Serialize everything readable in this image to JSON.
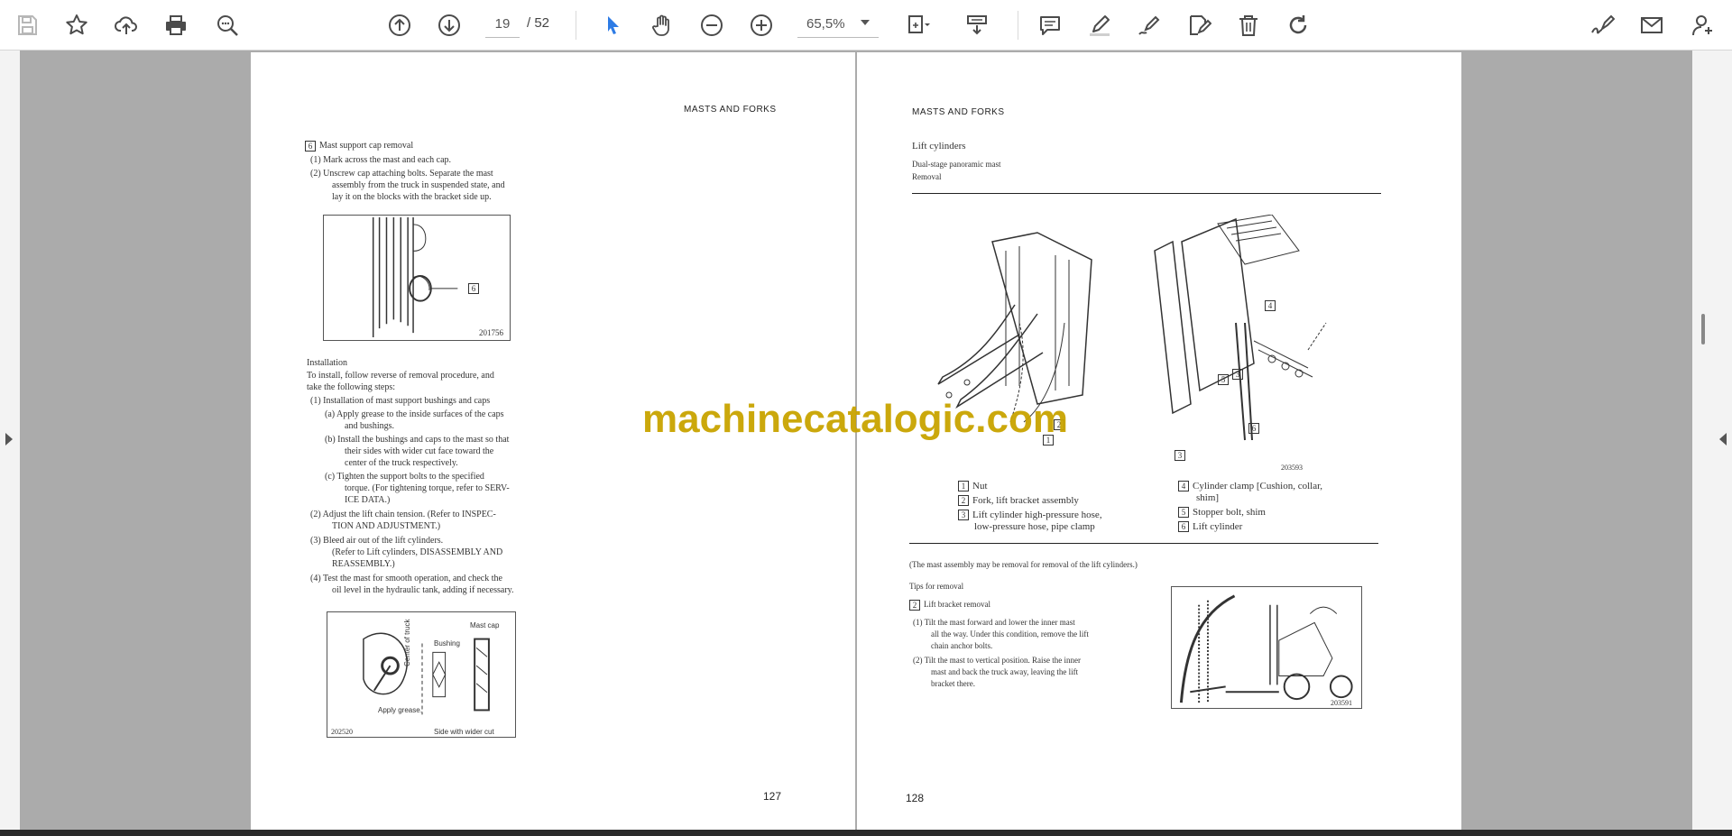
{
  "toolbar": {
    "page_current": "19",
    "page_total": "/ 52",
    "zoom": "65,5%"
  },
  "left_page": {
    "header": "MASTS AND FORKS",
    "step6_num": "6",
    "step6_title": "Mast support cap removal",
    "step6_1": "(1)  Mark across the mast and each cap.",
    "step6_2a": "(2)  Unscrew cap attaching bolts. Separate the mast",
    "step6_2b": "assembly from the truck in suspended state, and",
    "step6_2c": "lay it on the blocks with the bracket side up.",
    "fig1_callout": "6",
    "fig1_code": "201756",
    "install_title": "Installation",
    "install_intro_a": "To install, follow reverse of removal procedure, and",
    "install_intro_b": "take the following steps:",
    "install_1": "(1)  Installation of mast support bushings and caps",
    "install_1a_a": "(a)  Apply grease to the inside surfaces of the caps",
    "install_1a_b": "and bushings.",
    "install_1b_a": "(b)  Install the bushings and caps to the mast so that",
    "install_1b_b": "their sides with wider cut face toward the",
    "install_1b_c": "center of the truck respectively.",
    "install_1c_a": "(c)  Tighten the support bolts to the specified",
    "install_1c_b": "torque. (For tightening torque, refer to SERV-",
    "install_1c_c": "ICE DATA.)",
    "install_2a": "(2)  Adjust the lift chain tension. (Refer to INSPEC-",
    "install_2b": "TION AND ADJUSTMENT.)",
    "install_3a": "(3)  Bleed air out of the lift cylinders.",
    "install_3b": "(Refer to Lift cylinders, DISASSEMBLY AND",
    "install_3c": "REASSEMBLY.)",
    "install_4a": "(4)  Test the mast for smooth operation, and check the",
    "install_4b": "oil level in the hydraulic tank, adding if necessary.",
    "fig2_mast_cap": "Mast cap",
    "fig2_bushing": "Bushing",
    "fig2_center": "Center of truck",
    "fig2_grease": "Apply grease.",
    "fig2_side": "Side with wider cut",
    "fig2_code": "202520",
    "page_number": "127"
  },
  "right_page": {
    "header": "MASTS AND FORKS",
    "section_title": "Lift cylinders",
    "subsection": "Dual-stage panoramic mast",
    "removal": "Removal",
    "fig_code": "203593",
    "callout_1": "1",
    "callout_2": "2",
    "callout_3": "3",
    "callout_4": "4",
    "callout_5": "5",
    "callout_6": "6",
    "legend_1": "Nut",
    "legend_2": "Fork, lift bracket assembly",
    "legend_3a": "Lift cylinder high-pressure hose,",
    "legend_3b": "low-pressure hose, pipe clamp",
    "legend_4a": "Cylinder clamp [Cushion, collar,",
    "legend_4b": "shim]",
    "legend_5": "Stopper bolt, shim",
    "legend_6": "Lift cylinder",
    "note": "(The mast assembly may be removal for removal of the lift cylinders.)",
    "tips_title": "Tips for removal",
    "tip2_num": "2",
    "tip2_title": "Lift bracket removal",
    "tip2_1a": "(1)  Tilt the mast forward and lower the inner mast",
    "tip2_1b": "all the way. Under this condition, remove the lift",
    "tip2_1c": "chain anchor bolts.",
    "tip2_2a": "(2)  Tilt the mast to vertical position. Raise the inner",
    "tip2_2b": "mast and back the truck away, leaving the lift",
    "tip2_2c": "bracket there.",
    "fig3_code": "203591",
    "page_number": "128"
  },
  "watermark": "machinecatalogic.com",
  "colors": {
    "viewer_bg": "#ababab",
    "watermark": "#c9a400",
    "select_tool": "#2d7be5"
  }
}
